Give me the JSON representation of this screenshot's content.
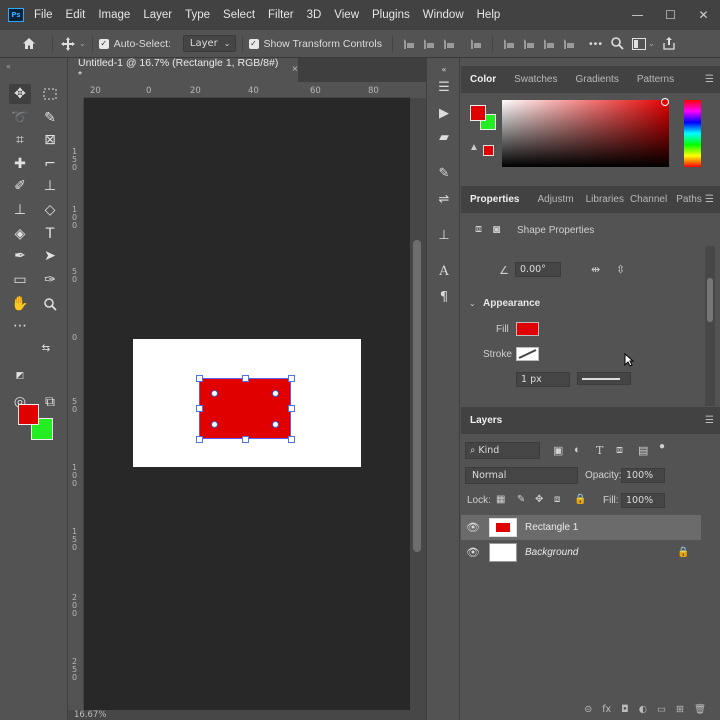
{
  "app": {
    "logo_text": "Ps"
  },
  "menubar": {
    "items": [
      "File",
      "Edit",
      "Image",
      "Layer",
      "Type",
      "Select",
      "Filter",
      "3D",
      "View",
      "Plugins",
      "Window",
      "Help"
    ],
    "window_controls": [
      "—",
      "☐",
      "✕"
    ]
  },
  "optionsbar": {
    "home_icon": "home-icon",
    "move_icon": "move-icon",
    "auto_select_label": "Auto-Select:",
    "auto_select_checked": true,
    "auto_select_target": "Layer",
    "show_transform_label": "Show Transform Controls",
    "show_transform_checked": true,
    "more_glyph": "•••"
  },
  "document": {
    "tab_title": "Untitled-1 @ 16.7% (Rectangle 1, RGB/8#) *",
    "close_glyph": "×",
    "zoom_status": "16.67%",
    "ruler_top_ticks": [
      "20",
      "0",
      "20",
      "40",
      "60",
      "80"
    ],
    "ruler_left_ticks": [
      "1 5 0",
      "1 0 0",
      "5 0",
      "0",
      "5 0",
      "1 0 0",
      "1 5 0",
      "2 0 0",
      "2 5 0"
    ],
    "fill_color": "#e00000",
    "page_color": "#ffffff"
  },
  "tools": {
    "foreground_color": "#e00000",
    "background_color": "#22ee22"
  },
  "color_panel": {
    "tabs": [
      "Color",
      "Swatches",
      "Gradients",
      "Patterns"
    ],
    "active_tab": "Color",
    "warning_glyph": "▲"
  },
  "properties_panel": {
    "tabs": [
      "Properties",
      "Adjustm",
      "Libraries",
      "Channel",
      "Paths"
    ],
    "section_title": "Shape Properties",
    "angle_value": "0.00°",
    "appearance_label": "Appearance",
    "fill_label": "Fill",
    "stroke_label": "Stroke",
    "stroke_width": "1 px",
    "fill_color": "#e00000"
  },
  "layers_panel": {
    "title": "Layers",
    "filter_kind": "Kind",
    "blend_mode": "Normal",
    "opacity_label": "Opacity:",
    "opacity_value": "100%",
    "lock_label": "Lock:",
    "fill_label": "Fill:",
    "fill_value": "100%",
    "layers": [
      {
        "name": "Rectangle 1",
        "selected": true,
        "locked": false
      },
      {
        "name": "Background",
        "selected": false,
        "locked": true
      }
    ],
    "footer_glyphs": [
      "⊝",
      "fx",
      "◘",
      "◐",
      "▭",
      "⊞",
      "🗑"
    ]
  }
}
